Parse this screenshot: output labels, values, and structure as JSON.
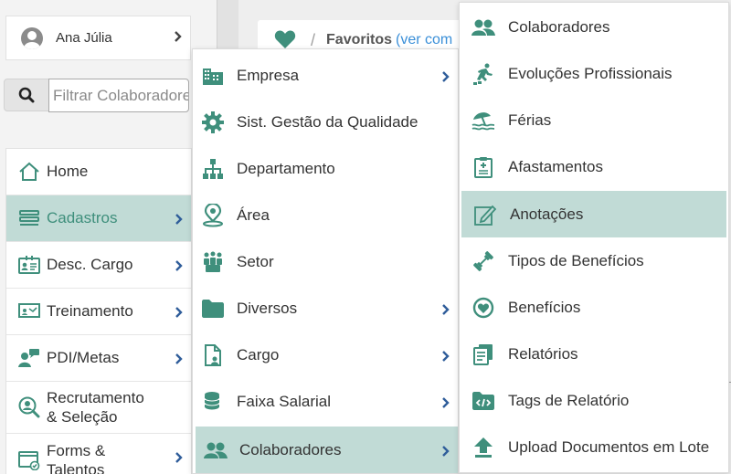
{
  "colors": {
    "accent": "#3f8f7c",
    "active_bg": "#c1dbd6",
    "link": "#3a8fd8"
  },
  "favorites": {
    "title": "Favoritos",
    "link": "(ver com"
  },
  "user": {
    "name": "Ana Júlia"
  },
  "search": {
    "placeholder": "Filtrar Colaboradores"
  },
  "sidebar": {
    "items": [
      {
        "label": "Home",
        "icon": "home-icon"
      },
      {
        "label": "Cadastros",
        "icon": "list-icon"
      },
      {
        "label": "Desc. Cargo",
        "icon": "id-card-icon"
      },
      {
        "label": "Treinamento",
        "icon": "presentation-icon"
      },
      {
        "label": "PDI/Metas",
        "icon": "person-chat-icon"
      },
      {
        "label": "Recrutamento",
        "label2": "& Seleção",
        "icon": "user-search-icon"
      },
      {
        "label": "Forms &",
        "label2": "Talentos",
        "icon": "form-window-icon"
      }
    ]
  },
  "submenu": {
    "items": [
      {
        "label": "Empresa",
        "icon": "building-icon"
      },
      {
        "label": "Sist. Gestão da Qualidade",
        "icon": "gear-icon"
      },
      {
        "label": "Departamento",
        "icon": "org-chart-icon"
      },
      {
        "label": "Área",
        "icon": "map-pin-icon"
      },
      {
        "label": "Setor",
        "icon": "team-icon"
      },
      {
        "label": "Diversos",
        "icon": "folder-icon"
      },
      {
        "label": "Cargo",
        "icon": "document-icon"
      },
      {
        "label": "Faixa Salarial",
        "icon": "coins-icon"
      },
      {
        "label": "Colaboradores",
        "icon": "users-icon"
      }
    ]
  },
  "submenu2": {
    "items": [
      {
        "label": "Colaboradores",
        "icon": "users-icon"
      },
      {
        "label": "Evoluções Profissionais",
        "icon": "stairs-runner-icon"
      },
      {
        "label": "Férias",
        "icon": "beach-umbrella-icon"
      },
      {
        "label": "Afastamentos",
        "icon": "medical-report-icon"
      },
      {
        "label": "Anotações",
        "icon": "edit-note-icon"
      },
      {
        "label": "Tipos de Benefícios",
        "icon": "dumbbell-icon"
      },
      {
        "label": "Benefícios",
        "icon": "heart-badge-icon"
      },
      {
        "label": "Relatórios",
        "icon": "reports-icon"
      },
      {
        "label": "Tags de Relatório",
        "icon": "code-folder-icon"
      },
      {
        "label": "Upload Documentos em Lote",
        "icon": "upload-icon"
      }
    ]
  }
}
